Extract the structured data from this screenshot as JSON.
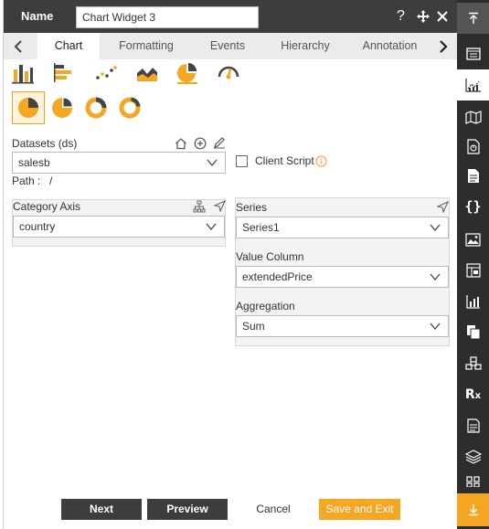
{
  "header": {
    "name_label": "Name",
    "name_value": "Chart Widget 3"
  },
  "tabs": [
    {
      "label": "Chart"
    },
    {
      "label": "Formatting"
    },
    {
      "label": "Events"
    },
    {
      "label": "Hierarchy"
    },
    {
      "label": "Annotation"
    }
  ],
  "datasets": {
    "label": "Datasets (ds)",
    "value": "salesb",
    "path_label": "Path :",
    "path_value": "/"
  },
  "client_script": {
    "label": "Client Script",
    "checked": false
  },
  "category_axis": {
    "label": "Category Axis",
    "value": "country"
  },
  "series": {
    "label": "Series",
    "value": "Series1",
    "value_column_label": "Value Column",
    "value_column": "extendedPrice",
    "aggregation_label": "Aggregation",
    "aggregation": "Sum"
  },
  "footer": {
    "next": "Next",
    "preview": "Preview",
    "cancel": "Cancel",
    "save_exit": "Save and Exit"
  },
  "colors": {
    "accent": "#f5a623",
    "header_bg": "#3d3d3d",
    "sidebar_bg": "#2d2d2d"
  },
  "chart_type_icons": [
    "bar-chart-icon",
    "horizontal-bar-chart-icon",
    "scatter-chart-icon",
    "area-chart-icon",
    "pie-chart-icon",
    "gauge-chart-icon"
  ],
  "pie_type_icons": [
    "pie-icon",
    "semi-pie-icon",
    "donut-icon",
    "semi-donut-icon"
  ],
  "sidebar_icons": [
    "scroll-top-icon",
    "widget-icon",
    "chart-icon",
    "map-icon",
    "document-chart-icon",
    "document-icon",
    "code-icon",
    "image-icon",
    "table-icon",
    "bar-widget-icon",
    "copy-icon",
    "cubes-icon",
    "rx-icon",
    "form-icon",
    "layers-icon",
    "grid-icon",
    "scroll-bottom-icon"
  ]
}
